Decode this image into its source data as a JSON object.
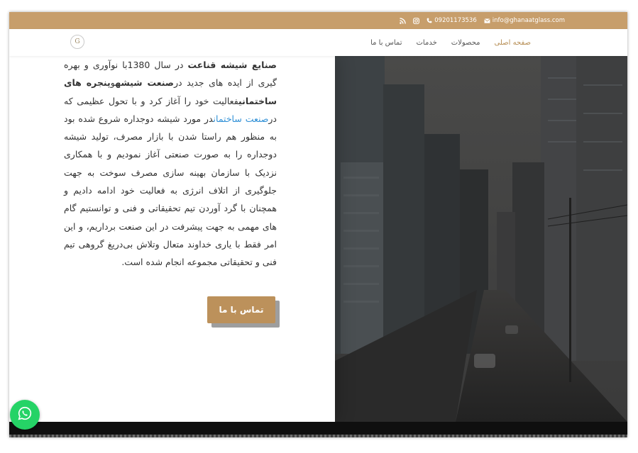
{
  "topbar": {
    "email": "info@ghanaatglass.com",
    "phone": "09201173536",
    "icons": [
      "mail-icon",
      "phone-icon",
      "instagram-icon",
      "rss-icon"
    ]
  },
  "logo": {
    "letter": "G"
  },
  "nav": {
    "items": [
      {
        "label": "صفحه اصلی",
        "active": true
      },
      {
        "label": "محصولات",
        "active": false
      },
      {
        "label": "خدمات",
        "active": false
      },
      {
        "label": "تماس با ما",
        "active": false
      }
    ]
  },
  "intro": {
    "p1_bold": "صنایع شیشه قناعت",
    "p1": " در سال 1380با نوآوری و بهره گیری از ایده های جدید در",
    "p2_bold": "صنعت شیشه",
    "p2": "و",
    "p3_bold": "پنجره های ساختمانی",
    "p3": "فعالیت خود را آغاز کرد و با تحول عظیمی که در",
    "p4_link": "صنعت ساختمان",
    "p4": "در مورد شیشه دوجداره شروع شده بود به منظور هم راستا شدن با بازار مصرف، تولید شیشه دوجداره را به صورت صنعتی آغاز نمودیم و با همکاری نزدیک با سازمان بهینه سازی مصرف سوخت به جهت جلوگیری از اتلاف انرژی به فعالیت خود ادامه دادیم و همچنان با گرد آوردن تیم تحقیقاتی و فنی و توانستیم گام های مهمی به جهت پیشرفت در این صنعت برداریم، و این امر فقط با یاری خداوند متعال وتلاش بی‌دریغ گروهی تیم فنی و تحقیقاتی مجموعه انجام شده است."
  },
  "cta": {
    "label": "تماس با ما"
  },
  "colors": {
    "topbar": "#c79e6b",
    "accent": "#b68d53",
    "button": "#bc915b",
    "link": "#2e8fd6",
    "whatsapp": "#25d366"
  }
}
